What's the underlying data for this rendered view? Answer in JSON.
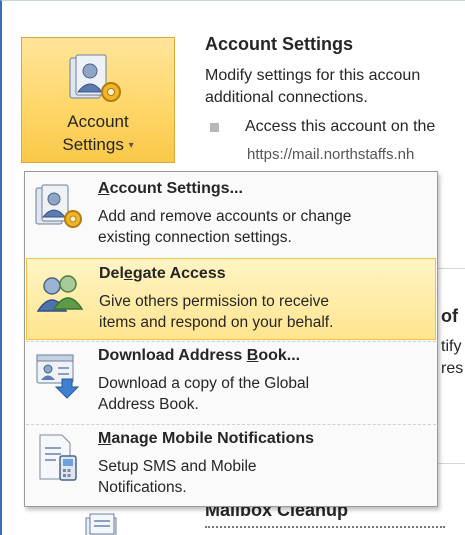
{
  "account_button": {
    "line1": "Account",
    "line2": "Settings",
    "caret": "▾"
  },
  "section": {
    "title": "Account Settings",
    "desc_line1": "Modify settings for this accoun",
    "desc_line2": "additional connections.",
    "bullet": "Access this account on the",
    "url": "https://mail.northstaffs.nh"
  },
  "background_fragments": {
    "side_heading": "of",
    "side_line1": "tify",
    "side_line2": "res",
    "bottom_heading": "Mailbox Cleanup"
  },
  "menu": {
    "items": [
      {
        "title_pre": "",
        "title_ul": "A",
        "title_post": "ccount Settings...",
        "desc1": "Add and remove accounts or change",
        "desc2": "existing connection settings.",
        "icon": "account-settings-icon"
      },
      {
        "title_pre": "Del",
        "title_ul": "e",
        "title_post": "gate Access",
        "desc1": "Give others permission to receive",
        "desc2": "items and respond on your behalf.",
        "icon": "delegate-users-icon"
      },
      {
        "title_pre": "Download Address ",
        "title_ul": "B",
        "title_post": "ook...",
        "desc1": "Download a copy of the Global",
        "desc2": "Address Book.",
        "icon": "address-book-download-icon"
      },
      {
        "title_pre": "",
        "title_ul": "M",
        "title_post": "anage Mobile Notifications",
        "desc1": "Setup SMS and Mobile",
        "desc2": "Notifications.",
        "icon": "mobile-notifications-icon"
      }
    ]
  }
}
